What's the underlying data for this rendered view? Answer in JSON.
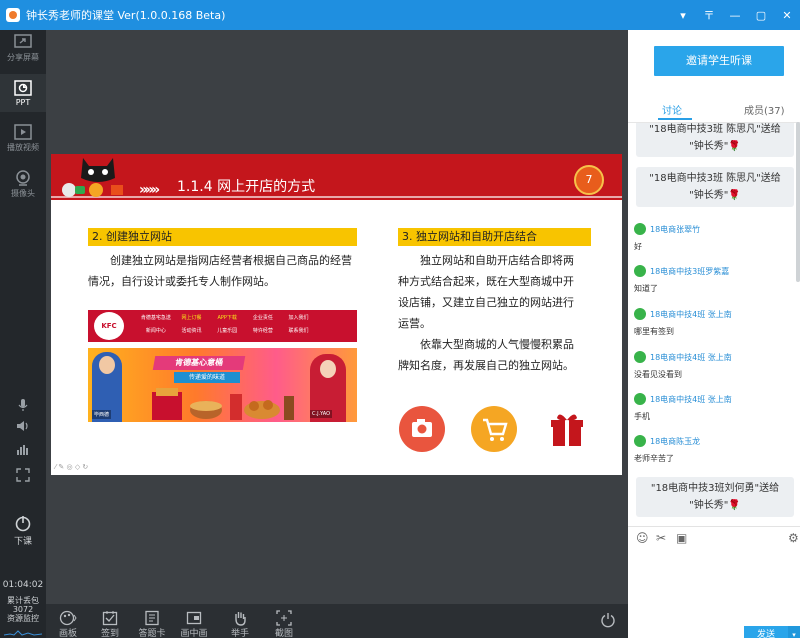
{
  "titlebar": {
    "title": "钟长秀老师的课堂 Ver(1.0.0.168 Beta)",
    "controls": [
      "▾",
      "〒",
      "—",
      "▢",
      "✕"
    ]
  },
  "leftbar": {
    "items": [
      {
        "label": "分享屏幕",
        "icon": "share-screen-icon"
      },
      {
        "label": "PPT",
        "icon": "ppt-icon"
      },
      {
        "label": "播放视频",
        "icon": "play-video-icon"
      },
      {
        "label": "摄像头",
        "icon": "camera-icon"
      }
    ],
    "end_class_label": "下课",
    "timer": "01:04:02",
    "traffic_label": "累计丢包",
    "traffic_value": "3072",
    "resource_label": "资源监控"
  },
  "slide": {
    "title": "1.1.4  网上开店的方式",
    "page_number": "7",
    "left_heading": "2. 创建独立网站",
    "left_paragraph": "创建独立网站是指网店经营者根据自己商品的经营情况，自行设计或委托专人制作网站。",
    "right_heading": "3. 独立网站和自助开店结合",
    "right_paragraph_1": "独立网站和自助开店结合即将两种方式结合起来，既在大型商城中开设店铺，又建立自己独立的网站进行运营。",
    "right_paragraph_2": "依靠大型商城的人气慢慢积累品牌知名度，再发展自己的独立网站。",
    "kfc": {
      "logo_text": "KFC",
      "nav_links": [
        "肯德基宅急送",
        "网上订餐",
        "APP下载",
        "企业责任",
        "加入我们",
        "新闻中心",
        "活动资讯",
        "儿童乐园",
        "特许经营",
        "联系我们"
      ],
      "headline": "肯德基心意桶",
      "subline": "传递爱的味道",
      "left_caption": "毕西德",
      "right_caption": "C.J.YAO"
    },
    "footer_icons": "⁄ ✎ ◎ ◇ ↻"
  },
  "bottombar": {
    "items": [
      {
        "label": "画板",
        "icon": "palette-icon"
      },
      {
        "label": "签到",
        "icon": "sign-in-icon"
      },
      {
        "label": "答题卡",
        "icon": "answer-card-icon"
      },
      {
        "label": "画中画",
        "icon": "picture-in-picture-icon"
      },
      {
        "label": "举手",
        "icon": "raise-hand-icon"
      },
      {
        "label": "截图",
        "icon": "screenshot-icon"
      }
    ]
  },
  "rightpanel": {
    "invite_label": "邀请学生听课",
    "tabs": [
      {
        "label": "讨论"
      },
      {
        "label": "成员(37)"
      }
    ],
    "gifts": [
      {
        "line1": "\"18电商中技3班 陈思凡\"送给",
        "line2": "\"钟长秀\""
      },
      {
        "line1": "\"18电商中技3班 陈思凡\"送给",
        "line2": "\"钟长秀\""
      },
      {
        "line1": "\"18电商中技3班刘何勇\"送给",
        "line2": "\"钟长秀\""
      }
    ],
    "messages": [
      {
        "user": "18电商张翠竹",
        "text": "好"
      },
      {
        "user": "18电商中技3班罗紫嘉",
        "text": "知道了"
      },
      {
        "user": "18电商中技4班 张上南",
        "text": "哪里有签到"
      },
      {
        "user": "18电商中技4班 张上南",
        "text": "没看见没看到"
      },
      {
        "user": "18电商中技4班 张上南",
        "text": "手机"
      },
      {
        "user": "18电商陈玉龙",
        "text": "老师辛苦了"
      }
    ],
    "send_label": "发送",
    "send_menu": "▾"
  },
  "colors": {
    "accent": "#2aa5ea",
    "titlebar": "#1f8fe0",
    "slide_red": "#c4161c",
    "slide_yellow": "#f8c400"
  }
}
